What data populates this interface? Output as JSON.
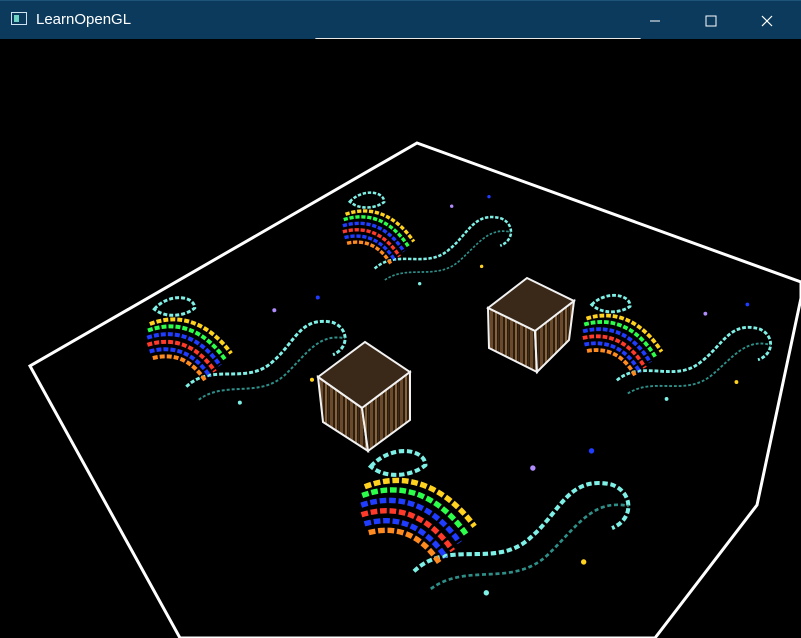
{
  "window": {
    "title": "LearnOpenGL",
    "icon": "window-app-icon",
    "controls": [
      "minimize-icon",
      "maximize-icon",
      "close-icon"
    ]
  },
  "colors": {
    "titlebar": "#0b3a5c",
    "title_text": "#ffffff",
    "viewport_background": "#000000",
    "plane_outline": "#ffffff",
    "snake_outline": "#7ff0e6",
    "stripe_blue": "#1f3cff",
    "stripe_red": "#ff3a2a",
    "stripe_green": "#2cff4a",
    "stripe_yellow": "#ffd21f",
    "stripe_orange": "#ff8a1f",
    "crate_edge": "#f2f2f2",
    "crate_wood": "#6b4a2b"
  },
  "scene": {
    "description_visible": false
  }
}
